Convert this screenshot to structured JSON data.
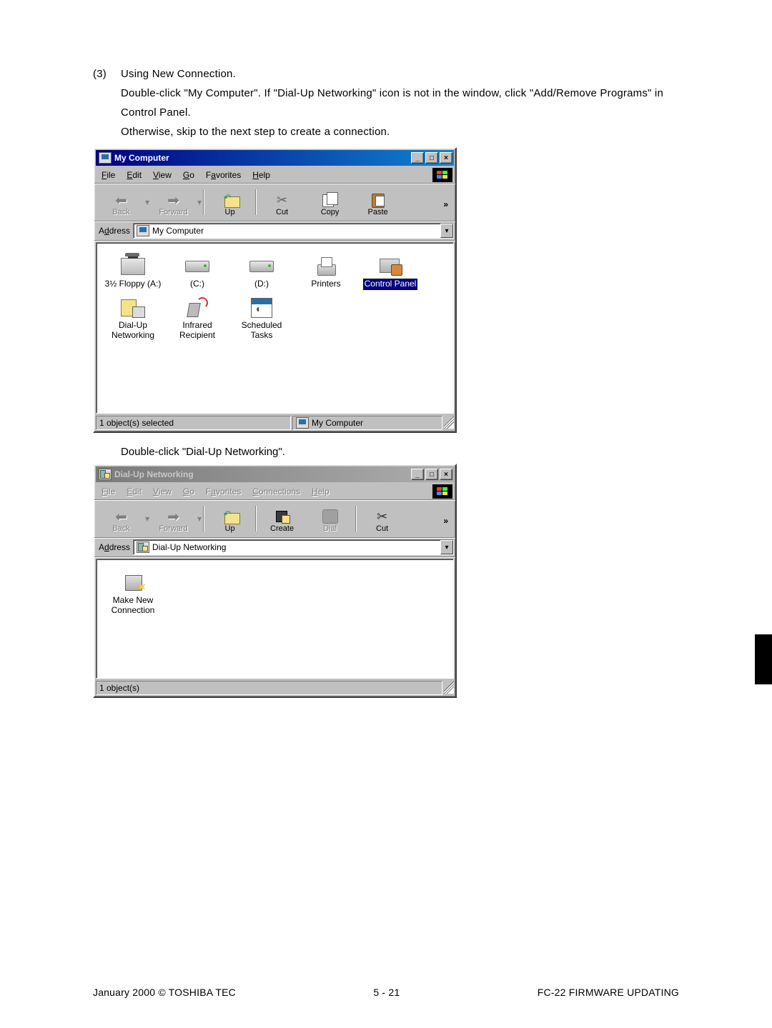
{
  "step": {
    "number": "(3)",
    "title": "Using New Connection.",
    "line1": "Double-click \"My Computer\". If \"Dial-Up Networking\" icon is not in the window, click \"Add/Remove Programs\" in Control Panel.",
    "line2": "Otherwise, skip to the next step to create a connection.",
    "caption2": "Double-click \"Dial-Up Networking\"."
  },
  "win1": {
    "title": "My Computer",
    "menus": {
      "file": "File",
      "edit": "Edit",
      "view": "View",
      "go": "Go",
      "fav": "Favorites",
      "help": "Help"
    },
    "toolbar": {
      "back": "Back",
      "forward": "Forward",
      "up": "Up",
      "cut": "Cut",
      "copy": "Copy",
      "paste": "Paste",
      "overflow": "»"
    },
    "addressLabel": "Address",
    "addressValue": "My Computer",
    "icons": {
      "floppy": "3½ Floppy (A:)",
      "c": "(C:)",
      "d": "(D:)",
      "printers": "Printers",
      "cpanel": "Control Panel",
      "dun": "Dial-Up Networking",
      "ir": "Infrared Recipient",
      "sched": "Scheduled Tasks"
    },
    "status": {
      "left": "1 object(s) selected",
      "right": "My Computer"
    }
  },
  "win2": {
    "title": "Dial-Up Networking",
    "menus": {
      "file": "File",
      "edit": "Edit",
      "view": "View",
      "go": "Go",
      "fav": "Favorites",
      "conn": "Connections",
      "help": "Help"
    },
    "toolbar": {
      "back": "Back",
      "forward": "Forward",
      "up": "Up",
      "create": "Create",
      "dial": "Dial",
      "cut": "Cut",
      "overflow": "»"
    },
    "addressLabel": "Address",
    "addressValue": "Dial-Up Networking",
    "icons": {
      "make": "Make New Connection"
    },
    "status": {
      "left": "1 object(s)"
    }
  },
  "footer": {
    "left": "January 2000  ©  TOSHIBA TEC",
    "center": "5 - 21",
    "right": "FC-22  FIRMWARE UPDATING"
  }
}
